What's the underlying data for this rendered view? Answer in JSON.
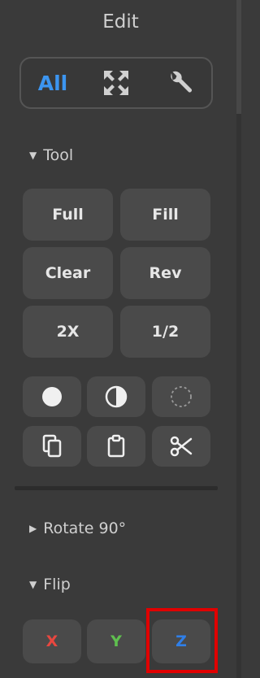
{
  "panel": {
    "title": "Edit"
  },
  "modes": [
    {
      "label": "All",
      "icon": null
    },
    {
      "label": null,
      "icon": "expand-arrows-icon"
    },
    {
      "label": null,
      "icon": "wrench-icon"
    }
  ],
  "sections": {
    "tool": {
      "label": "Tool",
      "expanded": true
    },
    "rotate": {
      "label": "Rotate 90°",
      "expanded": false
    },
    "flip": {
      "label": "Flip",
      "expanded": true
    }
  },
  "tool_buttons": {
    "full": "Full",
    "fill": "Fill",
    "clear": "Clear",
    "rev": "Rev",
    "double": "2X",
    "half": "1/2"
  },
  "tool_icons": [
    "filled-circle-icon",
    "half-circle-icon",
    "dashed-circle-icon",
    "copy-icon",
    "clipboard-icon",
    "scissors-icon"
  ],
  "flip_buttons": {
    "x": "X",
    "y": "Y",
    "z": "Z"
  },
  "colors": {
    "accent": "#3c95f0",
    "x_axis": "#e8473f",
    "y_axis": "#5fc04f",
    "z_axis": "#2f7fe8",
    "highlight": "#e00000"
  }
}
